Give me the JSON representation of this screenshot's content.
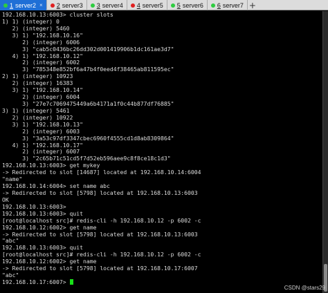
{
  "tabs": [
    {
      "num": "1",
      "label": "server2",
      "color": "#2ecc40",
      "active": true
    },
    {
      "num": "2",
      "label": "server3",
      "color": "#e02020",
      "active": false
    },
    {
      "num": "3",
      "label": "server4",
      "color": "#2ecc40",
      "active": false
    },
    {
      "num": "4",
      "label": "server5",
      "color": "#e02020",
      "active": false
    },
    {
      "num": "5",
      "label": "server6",
      "color": "#2ecc40",
      "active": false
    },
    {
      "num": "6",
      "label": "server7",
      "color": "#2ecc40",
      "active": false
    }
  ],
  "icons": {
    "tab_close": "close-icon",
    "new_tab": "plus-icon"
  },
  "tab_close_glyph": "×",
  "new_tab_glyph": "+",
  "terminal": {
    "lines": [
      "192.168.10.13:6003> cluster slots",
      "1) 1) (integer) 0",
      "   2) (integer) 5460",
      "   3) 1) \"192.168.10.16\"",
      "      2) (integer) 6006",
      "      3) \"cab5c0436bc26dd302d001419906b1dc161ae3d7\"",
      "   4) 1) \"192.168.10.12\"",
      "      2) (integer) 6002",
      "      3) \"785348e852bf6a47b4f0eed4f38465ab811595ec\"",
      "2) 1) (integer) 10923",
      "   2) (integer) 16383",
      "   3) 1) \"192.168.10.14\"",
      "      2) (integer) 6004",
      "      3) \"27e7c7069475449a6b4171a1f0c44b877df76885\"",
      "3) 1) (integer) 5461",
      "   2) (integer) 10922",
      "   3) 1) \"192.168.10.13\"",
      "      2) (integer) 6003",
      "      3) \"3a53c97df3347cbec6960f4555cd1d8ab8309864\"",
      "   4) 1) \"192.168.10.17\"",
      "      2) (integer) 6007",
      "      3) \"2c65b71c51cd5f7d52eb596aee9c8f8ce18c1d3\"",
      "192.168.10.13:6003> get mykey",
      "-> Redirected to slot [14687] located at 192.168.10.14:6004",
      "\"name\"",
      "192.168.10.14:6004> set name abc",
      "-> Redirected to slot [5798] located at 192.168.10.13:6003",
      "OK",
      "192.168.10.13:6003>",
      "192.168.10.13:6003> quit",
      "[root@localhost src]# redis-cli -h 192.168.10.12 -p 6002 -c",
      "192.168.10.12:6002> get name",
      "-> Redirected to slot [5798] located at 192.168.10.13:6003",
      "\"abc\"",
      "192.168.10.13:6003> quit",
      "[root@localhost src]# redis-cli -h 192.168.10.12 -p 6002 -c",
      "192.168.10.12:6002> get name",
      "-> Redirected to slot [5798] located at 192.168.10.17:6007",
      "\"abc\""
    ],
    "prompt": "192.168.10.17:6007> ",
    "text_color": "#dcdcdc",
    "cursor_color": "#18e018",
    "background": "#000000"
  },
  "watermark": "CSDN @stars29"
}
